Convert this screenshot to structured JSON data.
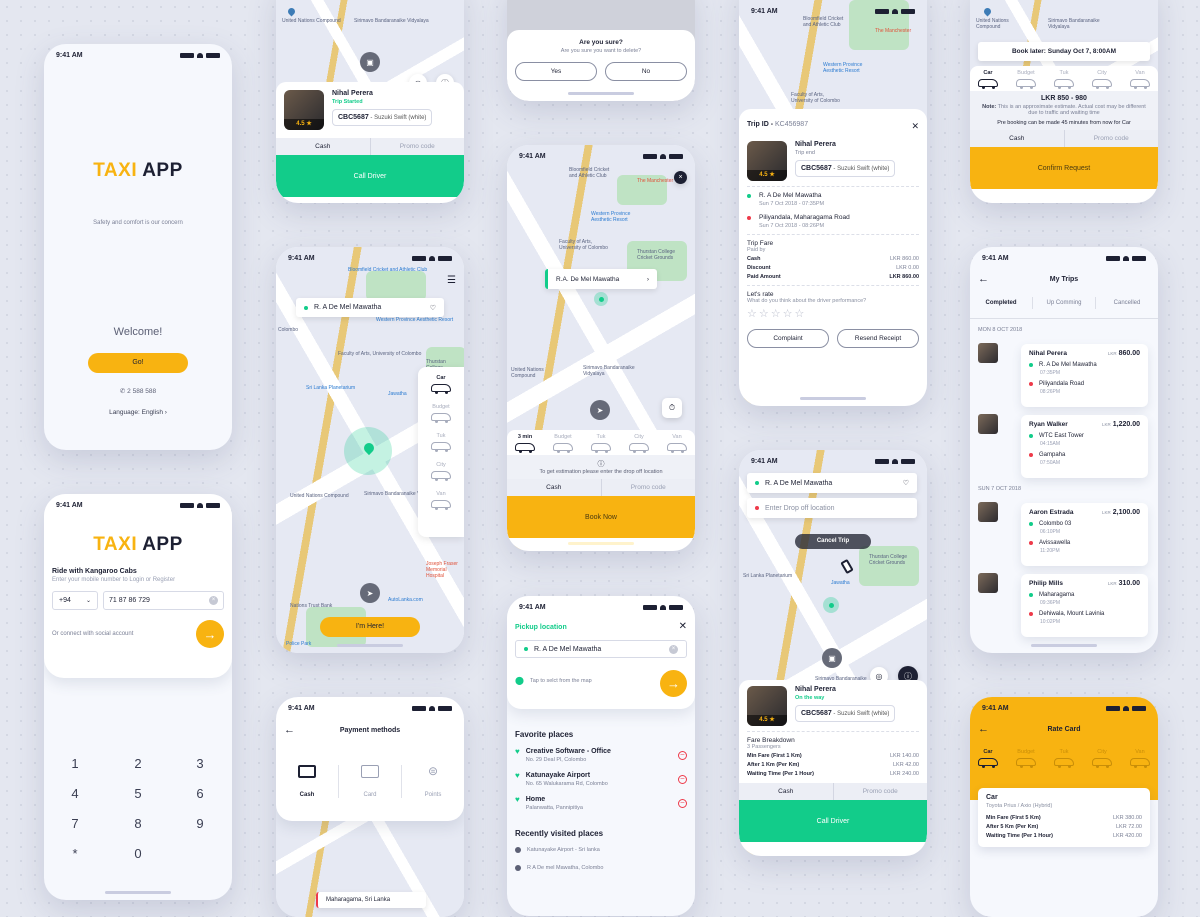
{
  "status_time": "9:41 AM",
  "brand": {
    "part1": "TAXI",
    "part2": "APP",
    "yellow": "#f8b311",
    "green": "#12cc8a",
    "red": "#ee3a4a"
  },
  "splash": {
    "tagline": "Safety and comfort is our concern",
    "welcome": "Welcome!",
    "go_label": "Go!",
    "phone": "2 588 588",
    "language": "Language: English ›"
  },
  "login": {
    "title": "Ride with Kangaroo Cabs",
    "subtitle": "Enter your mobile number to Login or Register",
    "country_code": "+94",
    "mobile_value": "71 87 86 729",
    "social_text": "Or connect with social account",
    "keypad": [
      "1",
      "2",
      "3",
      "4",
      "5",
      "6",
      "7",
      "8",
      "9",
      "*",
      "0"
    ]
  },
  "trip_started": {
    "map_labels": [
      "United Nations Compound",
      "Sirimavo Bandaranaike Vidyalaya"
    ],
    "driver_name": "Nihal Perera",
    "status": "Trip Started",
    "rating": "4.5",
    "plate": "CBC5687",
    "car": "- Suzuki Swift (white)",
    "payment": "Cash",
    "promo": "Promo code",
    "cta": "Call Driver"
  },
  "select_vehicle": {
    "pickup": "R. A De Mel Mawatha",
    "map_labels": [
      "Bloomfield Cricket and Athletic Club",
      "Western Province Aesthetic Resort",
      "Faculty of Arts, University of Colombo",
      "Sri Lanka Planetarium",
      "Thurstan College",
      "Jawatha",
      "United Nations Compound",
      "Sirimavo Bandaranaike Vidyalaya",
      "Joseph Fraser Memorial Hospital",
      "AutoLanka.com",
      "Nations Trust Bank",
      "Police Park",
      "Colombo"
    ],
    "vehicles": [
      "Car",
      "Budget",
      "Tuk",
      "City",
      "Van"
    ],
    "selected": "Car",
    "cta": "I'm Here!"
  },
  "payment_methods": {
    "title": "Payment methods",
    "options": [
      "Cash",
      "Card",
      "Points"
    ],
    "selected": "Cash",
    "bottom_location": "Maharagama, Sri Lanka"
  },
  "confirm_dialog": {
    "title": "Are you sure?",
    "message": "Are you sure you want to delete?",
    "yes": "Yes",
    "no": "No"
  },
  "book_now": {
    "pickup": "R.A. De Mel Mawatha",
    "vehicles": [
      "3 min",
      "Budget",
      "Tuk",
      "City",
      "Van"
    ],
    "info": "To get estimation please enter the drop off location",
    "payment": "Cash",
    "promo": "Promo code",
    "cta": "Book Now"
  },
  "pickup_search": {
    "title": "Pickup location",
    "value": "R. A De Mel Mawatha",
    "map_hint": "Tap to selct from the map",
    "favorites_title": "Favorite places",
    "favorites": [
      {
        "name": "Creative Software - Office",
        "address": "No. 29 Deal Pl, Colombo"
      },
      {
        "name": "Katunayake Airport",
        "address": "No. 65 Walukarama Rd, Colombo"
      },
      {
        "name": "Home",
        "address": "Palanwatta, Pannipitiya"
      }
    ],
    "recent_title": "Recently visited places",
    "recent": [
      "Katunayake Airport  - Sri lanka",
      "R A De mel Mawatha, Colombo"
    ]
  },
  "trip_receipt": {
    "trip_id_label": "Trip ID -",
    "trip_id": "KC456987",
    "driver_name": "Nihal Perera",
    "status": "Trip end",
    "rating": "4.5",
    "plate": "CBC5687",
    "car": "- Suzuki Swift (white)",
    "stops": [
      {
        "place": "R. A De Mel Mawatha",
        "time": "Sun 7 Oct 2018 - 07:35PM",
        "type": "pickup"
      },
      {
        "place": "Piliyandala, Maharagama Road",
        "time": "Sun 7 Oct 2018 - 08:26PM",
        "type": "drop"
      }
    ],
    "fare_title": "Trip Fare",
    "paid_by": "Paid by",
    "fare_rows": [
      {
        "label": "Cash",
        "value": "LKR 860.00"
      },
      {
        "label": "Discount",
        "value": "LKR 0.00"
      },
      {
        "label": "Paid Amount",
        "value": "LKR 860.00"
      }
    ],
    "rate_title": "Let's rate",
    "rate_question": "What do you think about the driver performance?",
    "stars": 0,
    "complaint": "Complaint",
    "resend": "Resend Receipt"
  },
  "on_the_way": {
    "pickup": "R. A De Mel Mawatha",
    "drop_placeholder": "Enter Drop off location",
    "cancel": "Cancel Trip",
    "driver_name": "Nihal Perera",
    "status": "On the way",
    "rating": "4.5",
    "plate": "CBC5687",
    "car": "- Suzuki Swift (white)",
    "fare_title": "Fare Breakdown",
    "passengers": "3 Passengers",
    "fare_rows": [
      {
        "label": "Min Fare (First 1 Km)",
        "value": "LKR 140.00"
      },
      {
        "label": "After 1  Km (Per Km)",
        "value": "LKR 42.00"
      },
      {
        "label": "Waiting Time (Per 1 Hour)",
        "value": "LKR 240.00"
      }
    ],
    "payment": "Cash",
    "promo": "Promo code",
    "cta": "Call Driver"
  },
  "book_later": {
    "banner": "Book later: Sunday Oct 7, 8:00AM",
    "vehicles": [
      "Car",
      "Budget",
      "Tuk",
      "City",
      "Van"
    ],
    "price": "LKR 850 - 980",
    "note_label": "Note:",
    "note": "This is an approximate estimate. Actual cost may be different due to traffic and waiting time",
    "prebook": "Pre booking can be made 45 minutes from now for Car",
    "payment": "Cash",
    "promo": "Promo code",
    "cta": "Confirm Request"
  },
  "my_trips": {
    "title": "My Trips",
    "tabs": [
      "Completed",
      "Up Comming",
      "Cancelled"
    ],
    "groups": [
      {
        "date": "MON 8 OCT 2018",
        "trips": [
          {
            "name": "Nihal Perera",
            "currency": "LKR",
            "amount": "860.00",
            "from": "R. A De Mel Mawatha",
            "from_time": "07:35PM",
            "to": "Piliyandala Road",
            "to_time": "08:26PM"
          },
          {
            "name": "Ryan Walker",
            "currency": "LKR",
            "amount": "1,220.00",
            "from": "WTC East Tower",
            "from_time": "04:15AM",
            "to": "Gampaha",
            "to_time": "07:50AM"
          }
        ]
      },
      {
        "date": "SUN 7 OCT 2018",
        "trips": [
          {
            "name": "Aaron Estrada",
            "currency": "LKR",
            "amount": "2,100.00",
            "from": "Colombo 03",
            "from_time": "06:10PM",
            "to": "Avissawella",
            "to_time": "11:20PM"
          },
          {
            "name": "Philip Mills",
            "currency": "LKR",
            "amount": "310.00",
            "from": "Maharagama",
            "from_time": "09:36PM",
            "to": "Dehiwala, Mount Lavinia",
            "to_time": "10:02PM"
          }
        ]
      }
    ]
  },
  "rate_card": {
    "title": "Rate Card",
    "vehicles": [
      "Car",
      "Budget",
      "Tuk",
      "City",
      "Van"
    ],
    "selected": "Car",
    "card_title": "Car",
    "card_sub": "Toyota Prius / Axio (Hybrid)",
    "rows": [
      {
        "label": "Min Fare (First 5 Km)",
        "value": "LKR 380.00"
      },
      {
        "label": "After 5  Km (Per Km)",
        "value": "LKR 72.00"
      },
      {
        "label": "Waiting Time (Per 1 Hour)",
        "value": "LKR 420.00"
      }
    ]
  }
}
